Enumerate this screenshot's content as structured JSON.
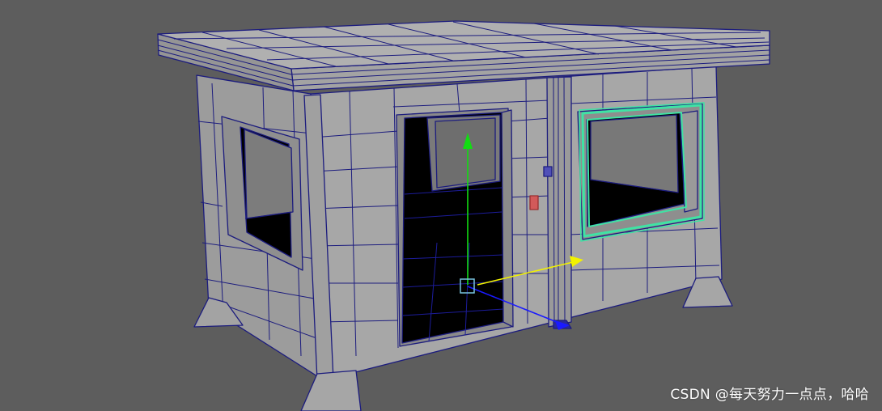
{
  "viewport": {
    "background": "#5d5d5d",
    "model_face_color": "#a6a6a6",
    "wire_color": "#1c1c7e",
    "selected_edge_color": "#3fe3a4",
    "pivot_colors": {
      "y_axis": "#12dd12",
      "x_axis": "#f2f200",
      "z_axis": "#1a1aff",
      "pivot_box": "#79c4e0"
    },
    "icons": [
      "y-axis-arrow",
      "x-axis-arrow",
      "z-axis-arrow",
      "pivot-box"
    ]
  },
  "watermark": {
    "text": "CSDN @每天努力一点点，哈哈"
  }
}
